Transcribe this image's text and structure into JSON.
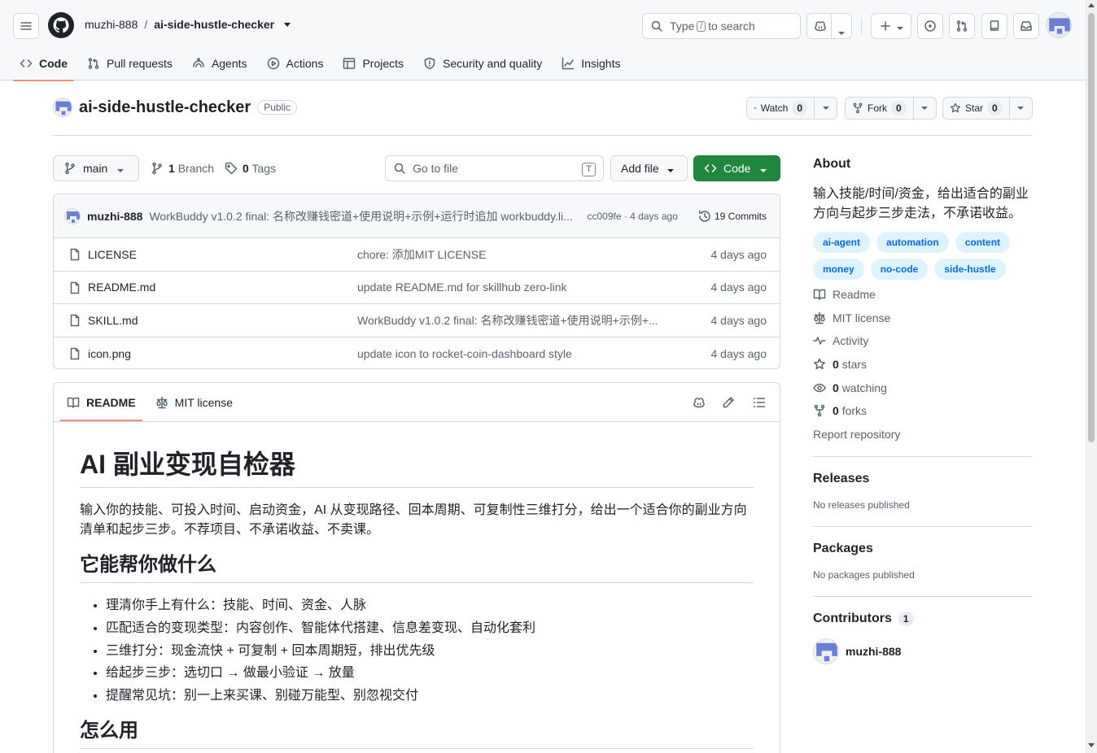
{
  "header": {
    "owner": "muzhi-888",
    "separator": "/",
    "repo": "ai-side-hustle-checker",
    "search_prefix": "Type",
    "search_key": "/",
    "search_suffix": "to search"
  },
  "tabs": [
    {
      "label": "Code",
      "icon": "code-icon"
    },
    {
      "label": "Pull requests",
      "icon": "pull-request-icon"
    },
    {
      "label": "Agents",
      "icon": "agents-icon"
    },
    {
      "label": "Actions",
      "icon": "play-icon"
    },
    {
      "label": "Projects",
      "icon": "table-icon"
    },
    {
      "label": "Security and quality",
      "icon": "shield-icon"
    },
    {
      "label": "Insights",
      "icon": "graph-icon"
    }
  ],
  "repo_header": {
    "name": "ai-side-hustle-checker",
    "visibility": "Public",
    "watch_label": "Watch",
    "watch_count": "0",
    "fork_label": "Fork",
    "fork_count": "0",
    "star_label": "Star",
    "star_count": "0"
  },
  "toolbar": {
    "branch": "main",
    "branch_count": "1",
    "branch_label": "Branch",
    "tag_count": "0",
    "tag_label": "Tags",
    "go_to_file": "Go to file",
    "go_to_file_key": "T",
    "add_file": "Add file",
    "code": "Code"
  },
  "latest_commit": {
    "author": "muzhi-888",
    "message": "WorkBuddy v1.0.2 final: 名称改赚钱密道+使用说明+示例+运行时追加 workbuddy.li...",
    "meta": "cc009fe · 4 days ago",
    "commits": "19 Commits"
  },
  "files": [
    {
      "name": "LICENSE",
      "message": "chore: 添加MIT LICENSE",
      "date": "4 days ago"
    },
    {
      "name": "README.md",
      "message": "update README.md for skillhub zero-link",
      "date": "4 days ago"
    },
    {
      "name": "SKILL.md",
      "message": "WorkBuddy v1.0.2 final: 名称改赚钱密道+使用说明+示例+...",
      "date": "4 days ago"
    },
    {
      "name": "icon.png",
      "message": "update icon to rocket-coin-dashboard style",
      "date": "4 days ago"
    }
  ],
  "readme": {
    "tab_readme": "README",
    "tab_license": "MIT license",
    "h1": "AI 副业变现自检器",
    "intro": "输入你的技能、可投入时间、启动资金，AI 从变现路径、回本周期、可复制性三维打分，给出一个适合你的副业方向清单和起步三步。不荐项目、不承诺收益、不卖课。",
    "h2_what": "它能帮你做什么",
    "bullets": [
      "理清你手上有什么：技能、时间、资金、人脉",
      "匹配适合的变现类型：内容创作、智能体代搭建、信息差变现、自动化套利",
      "三维打分：现金流快 + 可复制 + 回本周期短，排出优先级",
      "给起步三步：选切口 → 做最小验证 → 放量",
      "提醒常见坑：别一上来买课、别碰万能型、别忽视交付"
    ],
    "h2_how": "怎么用"
  },
  "sidebar": {
    "about_title": "About",
    "about_desc": "输入技能/时间/资金，给出适合的副业方向与起步三步走法，不承诺收益。",
    "topics": [
      "ai-agent",
      "automation",
      "content",
      "money",
      "no-code",
      "side-hustle"
    ],
    "readme": "Readme",
    "license": "MIT license",
    "activity": "Activity",
    "stars_count": "0",
    "stars_label": "stars",
    "watching_count": "0",
    "watching_label": "watching",
    "forks_count": "0",
    "forks_label": "forks",
    "report": "Report repository",
    "releases_title": "Releases",
    "releases_none": "No releases published",
    "packages_title": "Packages",
    "packages_none": "No packages published",
    "contributors_title": "Contributors",
    "contributors_count": "1",
    "contributor_name": "muzhi-888"
  },
  "colors": {
    "accent_green": "#1f883d",
    "tab_underline": "#fd8c73",
    "topic_bg": "#ddf4ff",
    "topic_fg": "#0969da"
  }
}
